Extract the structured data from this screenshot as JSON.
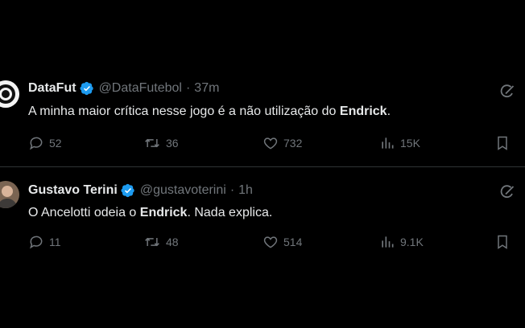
{
  "tweets": [
    {
      "name": "DataFut",
      "handle": "@DataFutebol",
      "dot": "·",
      "time": "37m",
      "text_before": "A minha maior crítica nesse jogo é a não utilização do ",
      "text_bold": "Endrick",
      "text_after": ".",
      "replies": "52",
      "retweets": "36",
      "likes": "732",
      "views": "15K"
    },
    {
      "name": "Gustavo Terini",
      "handle": "@gustavoterini",
      "dot": "·",
      "time": "1h",
      "text_before": "O Ancelotti odeia o ",
      "text_bold": "Endrick",
      "text_after": ". Nada explica.",
      "replies": "11",
      "retweets": "48",
      "likes": "514",
      "views": "9.1K"
    }
  ],
  "icons": {
    "verified": "verified-badge-icon",
    "grok": "grok-icon",
    "reply": "reply-icon",
    "retweet": "retweet-icon",
    "like": "heart-icon",
    "views": "views-icon",
    "bookmark": "bookmark-icon"
  },
  "colors": {
    "background": "#000000",
    "text": "#e7e9ea",
    "muted": "#71767b",
    "verified": "#1d9bf0",
    "divider": "#2f3336"
  }
}
